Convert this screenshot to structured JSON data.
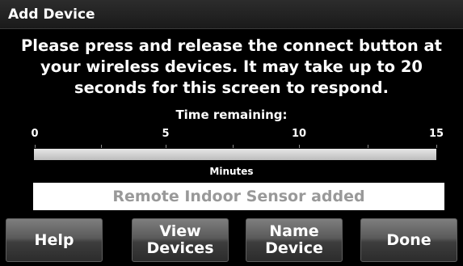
{
  "header": {
    "title": "Add Device"
  },
  "instructions": "Please press and release the connect button at your wireless devices. It may take up to 20 seconds for this screen to respond.",
  "timer": {
    "label": "Time remaining:",
    "ticks": [
      "0",
      "5",
      "10",
      "15"
    ],
    "units": "Minutes",
    "remaining_fraction": 1.0
  },
  "status": "Remote Indoor Sensor added",
  "buttons": {
    "help": "Help",
    "view_devices": "View\nDevices",
    "name_device": "Name\nDevice",
    "done": "Done"
  }
}
